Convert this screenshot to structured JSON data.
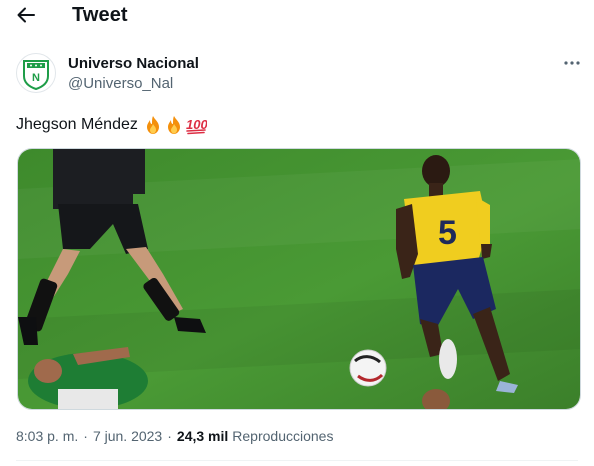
{
  "header": {
    "title": "Tweet"
  },
  "author": {
    "name": "Universo Nacional",
    "handle": "@Universo_Nal"
  },
  "tweet": {
    "text": "Jhegson Méndez",
    "emojis": [
      "fire",
      "fire",
      "hundred-points"
    ]
  },
  "media": {
    "jersey_number": "5"
  },
  "meta": {
    "time": "8:03 p. m.",
    "separator": "·",
    "date": "7 jun. 2023",
    "views_count": "24,3 mil",
    "views_label": "Reproducciones"
  },
  "colors": {
    "accent_text": "#0f1419",
    "secondary_text": "#536471",
    "pitch_green": "#3f8a2e",
    "logo_green": "#1e9d48"
  }
}
